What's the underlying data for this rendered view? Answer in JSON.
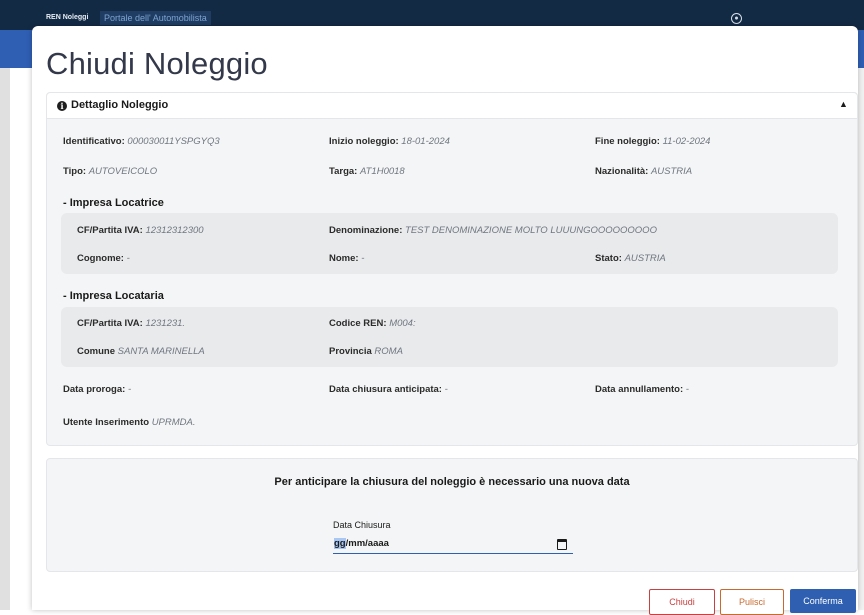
{
  "app": {
    "brand": "REN Noleggi",
    "portal_link": "Portale dell' Automobilista"
  },
  "modal": {
    "title": "Chiudi Noleggio",
    "panel_title": "Dettaglio Noleggio",
    "fields": {
      "identificativo": {
        "label": "Identificativo:",
        "value": "000030011YSPGYQ3"
      },
      "inizio": {
        "label": "Inizio noleggio:",
        "value": "18-01-2024"
      },
      "fine": {
        "label": "Fine noleggio:",
        "value": "11-02-2024"
      },
      "tipo": {
        "label": "Tipo:",
        "value": "AUTOVEICOLO"
      },
      "targa": {
        "label": "Targa:",
        "value": "AT1H0018"
      },
      "nazionalita": {
        "label": "Nazionalità:",
        "value": "AUSTRIA"
      }
    },
    "locatrice": {
      "title": "- Impresa Locatrice",
      "cf": {
        "label": "CF/Partita IVA:",
        "value": "12312312300"
      },
      "denominazione": {
        "label": "Denominazione:",
        "value": "TEST DENOMINAZIONE MOLTO LUUUNGOOOOOOOOO"
      },
      "cognome": {
        "label": "Cognome:",
        "value": "-"
      },
      "nome": {
        "label": "Nome:",
        "value": "-"
      },
      "stato": {
        "label": "Stato:",
        "value": "AUSTRIA"
      }
    },
    "locataria": {
      "title": "- Impresa Locataria",
      "cf": {
        "label": "CF/Partita IVA:",
        "value": "1231231."
      },
      "codice_ren": {
        "label": "Codice REN:",
        "value": "M004:"
      },
      "comune": {
        "label": "Comune",
        "value": "SANTA MARINELLA"
      },
      "provincia": {
        "label": "Provincia",
        "value": "ROMA"
      }
    },
    "extra": {
      "proroga": {
        "label": "Data proroga:",
        "value": "-"
      },
      "chiusura_anticipata": {
        "label": "Data chiusura anticipata:",
        "value": "-"
      },
      "annullamento": {
        "label": "Data annullamento:",
        "value": "-"
      },
      "utente": {
        "label": "Utente Inserimento",
        "value": "UPRMDA."
      }
    },
    "close_form": {
      "message": "Per anticipare la chiusura del noleggio è necessario una nuova data",
      "date_label": "Data Chiusura",
      "date_placeholder_first": "gg",
      "date_placeholder_rest": "/mm/aaaa"
    },
    "buttons": {
      "chiudi": "Chiudi",
      "pulisci": "Pulisci",
      "conferma": "Conferma"
    }
  },
  "colors": {
    "primary": "#2e5fb0",
    "danger": "#c84040",
    "warning": "#c86a30",
    "header_bg": "#132a45"
  }
}
